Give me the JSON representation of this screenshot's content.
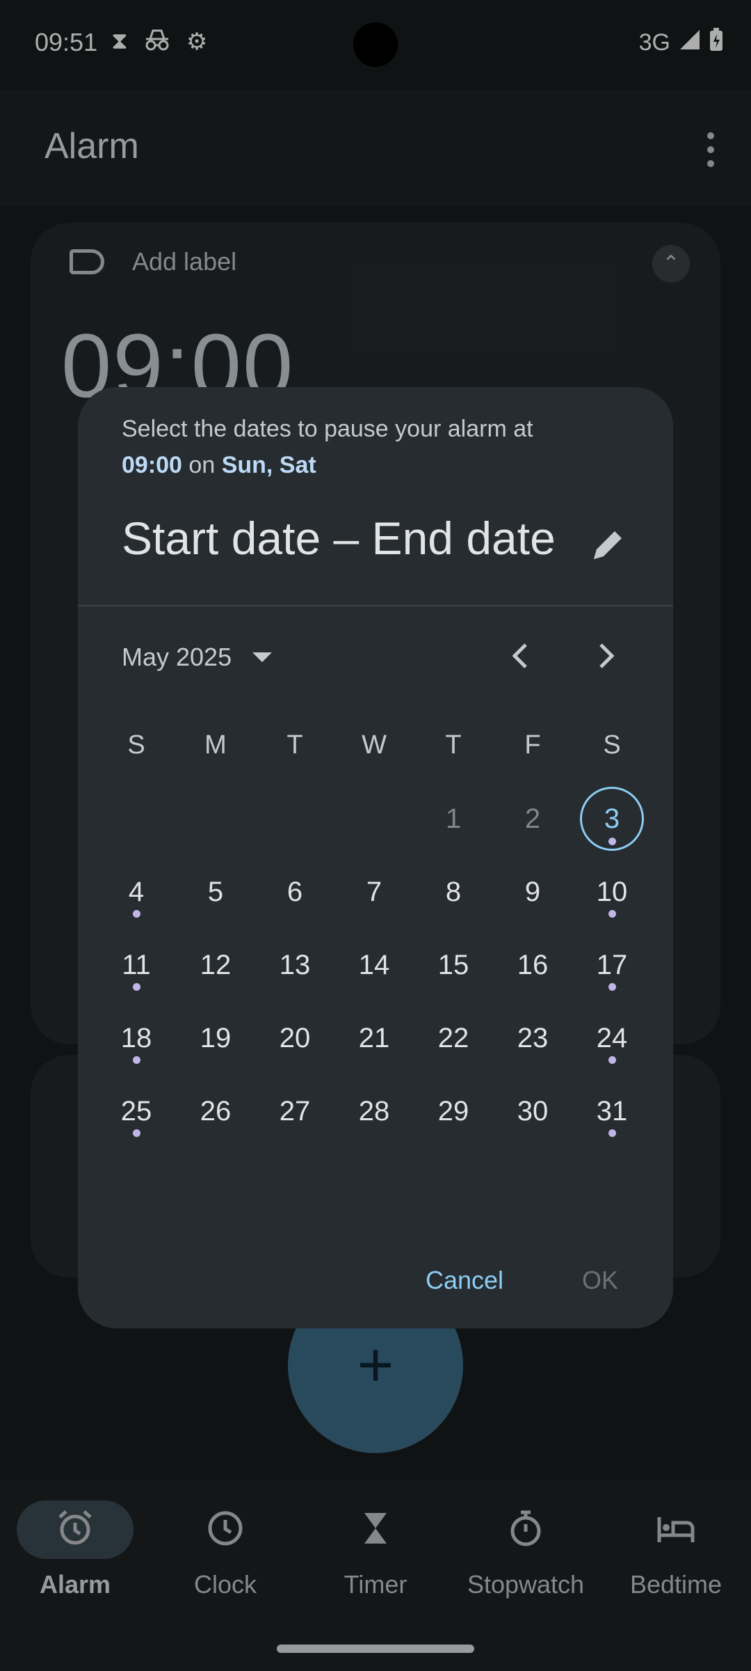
{
  "status_bar": {
    "time": "09:51",
    "icons": [
      "hourglass-icon",
      "incognito-icon",
      "settings-gear-icon"
    ],
    "network": "3G"
  },
  "app_bar": {
    "title": "Alarm"
  },
  "alarm_card": {
    "add_label": "Add label",
    "time": "09:00"
  },
  "dialog": {
    "headline_prefix": "Select the dates to pause your alarm at ",
    "headline_time": "09:00",
    "headline_mid": " on ",
    "headline_days": "Sun, Sat",
    "range_title": "Start date – End date",
    "month_label": "May 2025",
    "weekdays": [
      "S",
      "M",
      "T",
      "W",
      "T",
      "F",
      "S"
    ],
    "days": [
      {
        "n": "1",
        "state": "past"
      },
      {
        "n": "2",
        "state": "past"
      },
      {
        "n": "3",
        "state": "today",
        "dot": true
      },
      {
        "n": "4",
        "dot": true
      },
      {
        "n": "5"
      },
      {
        "n": "6"
      },
      {
        "n": "7"
      },
      {
        "n": "8"
      },
      {
        "n": "9"
      },
      {
        "n": "10",
        "dot": true
      },
      {
        "n": "11",
        "dot": true
      },
      {
        "n": "12"
      },
      {
        "n": "13"
      },
      {
        "n": "14"
      },
      {
        "n": "15"
      },
      {
        "n": "16"
      },
      {
        "n": "17",
        "dot": true
      },
      {
        "n": "18",
        "dot": true
      },
      {
        "n": "19"
      },
      {
        "n": "20"
      },
      {
        "n": "21"
      },
      {
        "n": "22"
      },
      {
        "n": "23"
      },
      {
        "n": "24",
        "dot": true
      },
      {
        "n": "25",
        "dot": true
      },
      {
        "n": "26"
      },
      {
        "n": "27"
      },
      {
        "n": "28"
      },
      {
        "n": "29"
      },
      {
        "n": "30"
      },
      {
        "n": "31",
        "dot": true
      }
    ],
    "first_weekday_index": 4,
    "cancel_label": "Cancel",
    "ok_label": "OK"
  },
  "fab_symbol": "+",
  "bottom_nav": [
    {
      "label": "Alarm",
      "icon": "alarm-clock-icon",
      "active": true
    },
    {
      "label": "Clock",
      "icon": "clock-icon",
      "active": false
    },
    {
      "label": "Timer",
      "icon": "hourglass-icon",
      "active": false
    },
    {
      "label": "Stopwatch",
      "icon": "stopwatch-icon",
      "active": false
    },
    {
      "label": "Bedtime",
      "icon": "bed-icon",
      "active": false
    }
  ],
  "colors": {
    "accent": "#8ecdf4",
    "dialog_bg": "#262c30",
    "event_dot": "#c3b4e8"
  }
}
